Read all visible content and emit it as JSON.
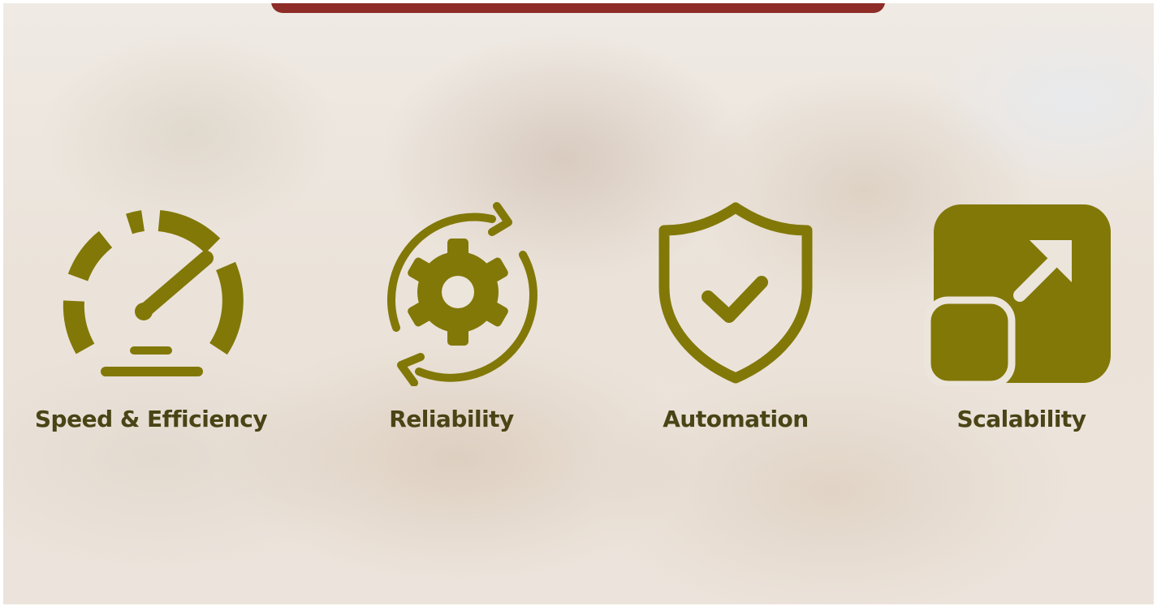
{
  "colors": {
    "icon": "#827808",
    "label": "#4a4416",
    "top_bar": "#8e2c27"
  },
  "features": [
    {
      "label": "Speed & Efficiency",
      "icon": "speedometer-icon"
    },
    {
      "label": "Reliability",
      "icon": "gear-refresh-icon"
    },
    {
      "label": "Automation",
      "icon": "shield-check-icon"
    },
    {
      "label": "Scalability",
      "icon": "expand-arrow-icon"
    }
  ]
}
